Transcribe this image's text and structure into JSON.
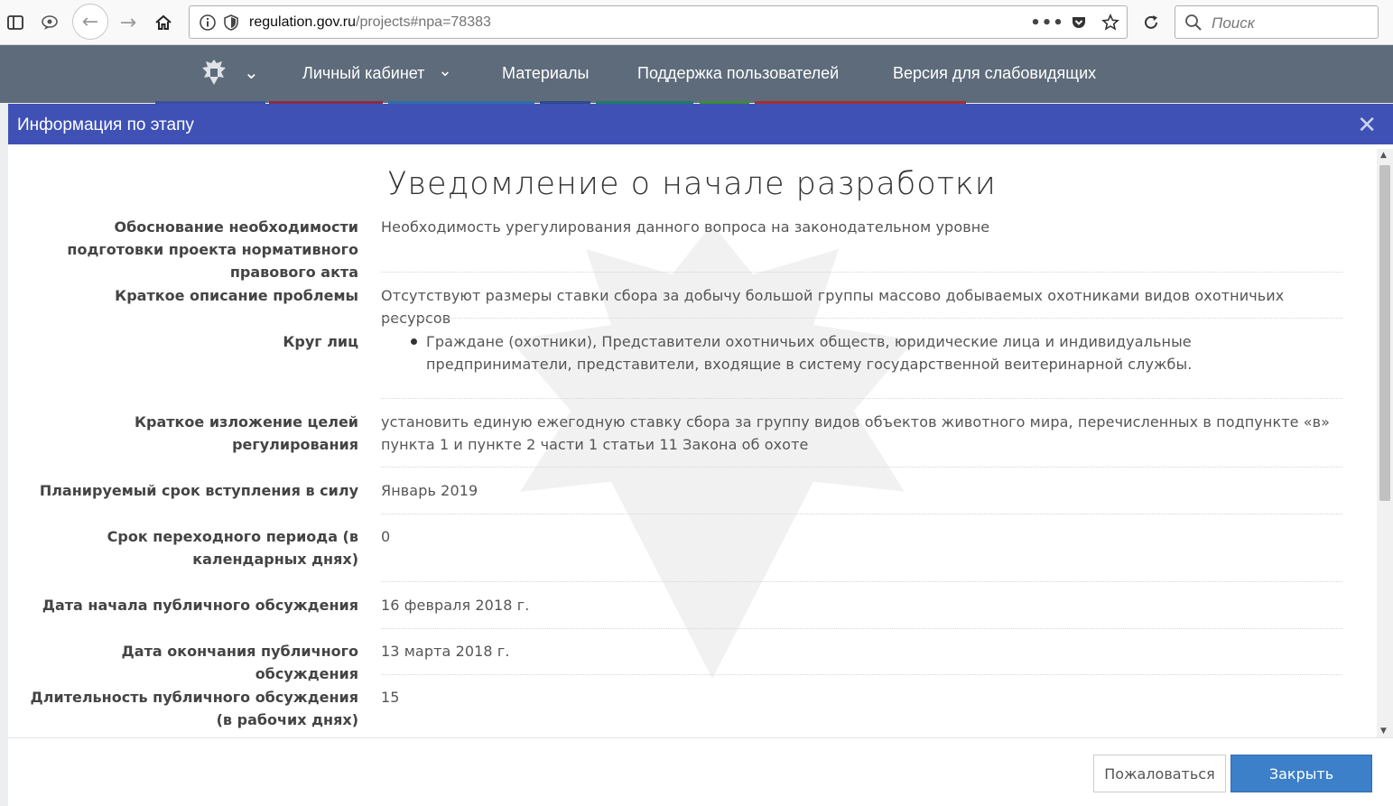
{
  "browser": {
    "url_host": "regulation.gov.ru",
    "url_path": "/projects#npa=78383",
    "search_placeholder": "Поиск",
    "icons": [
      "sidebar-icon",
      "speech-bubble-icon",
      "back-icon",
      "forward-icon",
      "home-icon",
      "info-icon",
      "shield-icon",
      "more-icon",
      "pocket-icon",
      "star-icon",
      "reload-icon",
      "search-icon"
    ]
  },
  "nav": {
    "items": [
      "Личный кабинет",
      "Материалы",
      "Поддержка пользователей",
      "Версия для слабовидящих"
    ],
    "logo": "coat-of-arms-icon"
  },
  "modal": {
    "title": "Информация по этапу",
    "heading": "Уведомление о начале разработки",
    "rows": [
      {
        "label": "Обоснование необходимости подготовки проекта нормативного правового акта",
        "value": "Необходимость урегулирования данного вопроса на законодательном уровне"
      },
      {
        "label": "Краткое описание проблемы",
        "value": "Отсутствуют размеры ставки сбора за добычу большой группы массово добываемых охотниками видов охотничьих ресурсов"
      },
      {
        "label": "Круг лиц",
        "value": "Граждане (охотники), Представители охотничьих обществ, юридические лица и индивидуальные предприниматели, представители, входящие в систему государственной веитеринарной службы."
      },
      {
        "label": "Краткое изложение целей регулирования",
        "value": "установить единую ежегодную ставку сбора за группу видов объектов животного мира, перечисленных в подпункте «в» пункта 1 и пункте 2 части 1 статьи 11 Закона об охоте"
      },
      {
        "label": "Планируемый срок вступления в силу",
        "value": "Январь 2019"
      },
      {
        "label": "Срок переходного периода (в календарных днях)",
        "value": "0"
      },
      {
        "label": "Дата начала публичного обсуждения",
        "value": "16 февраля 2018 г."
      },
      {
        "label": "Дата окончания публичного обсуждения",
        "value": "13 марта 2018 г."
      },
      {
        "label": "Длительность публичного обсуждения (в рабочих днях)",
        "value": "15"
      }
    ],
    "buttons": {
      "complain": "Пожаловаться",
      "close": "Закрыть"
    },
    "colors": {
      "header": "#3f51b5",
      "primary_button": "#3b80c8",
      "nav": "#5e6b7a"
    }
  }
}
